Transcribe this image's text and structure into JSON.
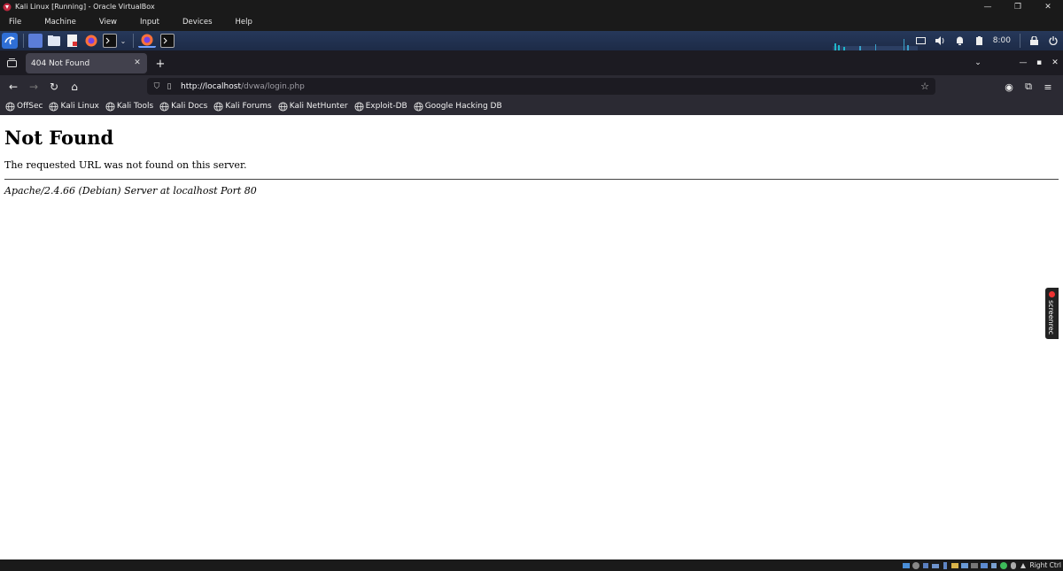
{
  "vbox": {
    "title": "Kali Linux [Running] - Oracle VirtualBox",
    "menu": [
      "File",
      "Machine",
      "View",
      "Input",
      "Devices",
      "Help"
    ],
    "host_key": "Right Ctrl"
  },
  "panel": {
    "clock": "8:00",
    "accent_color": "#2f6fd6"
  },
  "browser": {
    "tab_title": "404 Not Found",
    "url_host": "http://localhost",
    "url_path": "/dvwa/login.php",
    "bookmarks": [
      "OffSec",
      "Kali Linux",
      "Kali Tools",
      "Kali Docs",
      "Kali Forums",
      "Kali NetHunter",
      "Exploit-DB",
      "Google Hacking DB"
    ]
  },
  "page": {
    "heading": "Not Found",
    "message": "The requested URL was not found on this server.",
    "server_signature": "Apache/2.4.66 (Debian) Server at localhost Port 80"
  },
  "overlay": {
    "screenrec_label": "screenrec"
  }
}
